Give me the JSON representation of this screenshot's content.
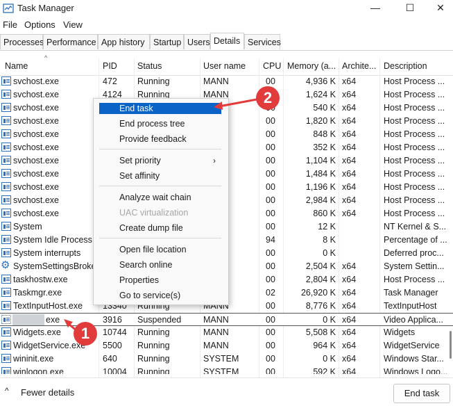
{
  "window": {
    "title": "Task Manager",
    "controls": [
      "—",
      "☐",
      "✕"
    ]
  },
  "menu": [
    "File",
    "Options",
    "View"
  ],
  "tabs": [
    "Processes",
    "Performance",
    "App history",
    "Startup",
    "Users",
    "Details",
    "Services"
  ],
  "active_tab": "Details",
  "columns": [
    "Name",
    "PID",
    "Status",
    "User name",
    "CPU",
    "Memory (a...",
    "Archite...",
    "Description"
  ],
  "rows": [
    {
      "name": "svchost.exe",
      "pid": "472",
      "status": "Running",
      "user": "MANN",
      "cpu": "00",
      "mem": "4,936 K",
      "arch": "x64",
      "desc": "Host Process ..."
    },
    {
      "name": "svchost.exe",
      "pid": "4124",
      "status": "Running",
      "user": "MANN",
      "cpu": "00",
      "mem": "1,624 K",
      "arch": "x64",
      "desc": "Host Process ..."
    },
    {
      "name": "svchost.exe",
      "pid": "",
      "status": "",
      "user": "",
      "cpu": "00",
      "mem": "540 K",
      "arch": "x64",
      "desc": "Host Process ..."
    },
    {
      "name": "svchost.exe",
      "pid": "",
      "status": "",
      "user": "",
      "cpu": "00",
      "mem": "1,820 K",
      "arch": "x64",
      "desc": "Host Process ..."
    },
    {
      "name": "svchost.exe",
      "pid": "",
      "status": "",
      "user": "",
      "cpu": "00",
      "mem": "848 K",
      "arch": "x64",
      "desc": "Host Process ..."
    },
    {
      "name": "svchost.exe",
      "pid": "",
      "status": "",
      "user": "L SE...",
      "cpu": "00",
      "mem": "352 K",
      "arch": "x64",
      "desc": "Host Process ..."
    },
    {
      "name": "svchost.exe",
      "pid": "",
      "status": "",
      "user": "ORK...",
      "cpu": "00",
      "mem": "1,104 K",
      "arch": "x64",
      "desc": "Host Process ..."
    },
    {
      "name": "svchost.exe",
      "pid": "",
      "status": "",
      "user": "M",
      "cpu": "00",
      "mem": "1,484 K",
      "arch": "x64",
      "desc": "Host Process ..."
    },
    {
      "name": "svchost.exe",
      "pid": "",
      "status": "",
      "user": "M",
      "cpu": "00",
      "mem": "1,196 K",
      "arch": "x64",
      "desc": "Host Process ..."
    },
    {
      "name": "svchost.exe",
      "pid": "",
      "status": "",
      "user": "M",
      "cpu": "00",
      "mem": "2,984 K",
      "arch": "x64",
      "desc": "Host Process ..."
    },
    {
      "name": "svchost.exe",
      "pid": "",
      "status": "",
      "user": "L SE...",
      "cpu": "00",
      "mem": "860 K",
      "arch": "x64",
      "desc": "Host Process ..."
    },
    {
      "name": "System",
      "pid": "",
      "status": "",
      "user": "M",
      "cpu": "00",
      "mem": "12 K",
      "arch": "",
      "desc": "NT Kernel & S..."
    },
    {
      "name": "System Idle Process",
      "pid": "",
      "status": "",
      "user": "M",
      "cpu": "94",
      "mem": "8 K",
      "arch": "",
      "desc": "Percentage of ..."
    },
    {
      "name": "System interrupts",
      "pid": "",
      "status": "",
      "user": "M",
      "cpu": "00",
      "mem": "0 K",
      "arch": "",
      "desc": "Deferred proc..."
    },
    {
      "name": "SystemSettingsBroke...",
      "pid": "",
      "status": "",
      "user": "",
      "cpu": "00",
      "mem": "2,504 K",
      "arch": "x64",
      "desc": "System Settin..."
    },
    {
      "name": "taskhostw.exe",
      "pid": "",
      "status": "",
      "user": "",
      "cpu": "00",
      "mem": "2,804 K",
      "arch": "x64",
      "desc": "Host Process ..."
    },
    {
      "name": "Taskmgr.exe",
      "pid": "",
      "status": "",
      "user": "",
      "cpu": "02",
      "mem": "26,920 K",
      "arch": "x64",
      "desc": "Task Manager"
    },
    {
      "name": "TextInputHost.exe",
      "pid": "13340",
      "status": "Running",
      "user": "MANN",
      "cpu": "00",
      "mem": "8,776 K",
      "arch": "x64",
      "desc": "TextInputHost"
    },
    {
      "name": "exe",
      "pid": "3916",
      "status": "Suspended",
      "user": "MANN",
      "cpu": "00",
      "mem": "0 K",
      "arch": "x64",
      "desc": "Video Applica..."
    },
    {
      "name": "Widgets.exe",
      "pid": "10744",
      "status": "Running",
      "user": "MANN",
      "cpu": "00",
      "mem": "5,508 K",
      "arch": "x64",
      "desc": "Widgets"
    },
    {
      "name": "WidgetService.exe",
      "pid": "5500",
      "status": "Running",
      "user": "MANN",
      "cpu": "00",
      "mem": "964 K",
      "arch": "x64",
      "desc": "WidgetService"
    },
    {
      "name": "wininit.exe",
      "pid": "640",
      "status": "Running",
      "user": "SYSTEM",
      "cpu": "00",
      "mem": "0 K",
      "arch": "x64",
      "desc": "Windows Star..."
    },
    {
      "name": "winlogon.exe",
      "pid": "10004",
      "status": "Running",
      "user": "SYSTEM",
      "cpu": "00",
      "mem": "592 K",
      "arch": "x64",
      "desc": "Windows Logo..."
    }
  ],
  "context_menu": {
    "items": [
      "End task",
      "End process tree",
      "Provide feedback",
      "Set priority",
      "Set affinity",
      "Analyze wait chain",
      "UAC virtualization",
      "Create dump file",
      "Open file location",
      "Search online",
      "Properties",
      "Go to service(s)"
    ],
    "disabled": [
      "UAC virtualization"
    ],
    "highlighted": "End task"
  },
  "annotations": {
    "badge1": "1",
    "badge2": "2",
    "color": "#e23b3b"
  },
  "footer": {
    "fewer_details": "Fewer details",
    "end_task": "End task"
  }
}
